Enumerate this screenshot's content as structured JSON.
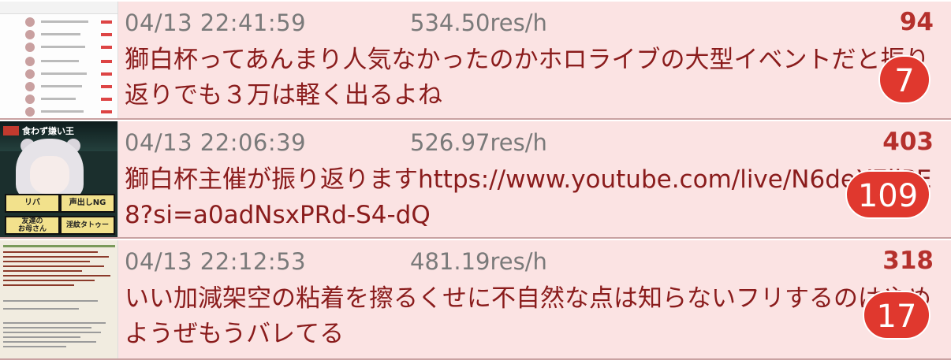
{
  "threads": [
    {
      "date": "04/13 22:41:59",
      "speed": "534.50res/h",
      "count": "94",
      "title": "獅白杯ってあんまり人気なかったのかホロライブの大型イベントだと振り返りでも３万は軽く出るよね",
      "badge": "7",
      "thumbnail": "list-screenshot"
    },
    {
      "date": "04/13 22:06:39",
      "speed": "526.97res/h",
      "count": "403",
      "title": "獅白杯主催が振り返りますhttps://www.youtube.com/live/N6deX7jjPE8?si=a0adNsxPRd-S4-dQ",
      "badge": "109",
      "thumbnail": "stream-screenshot",
      "thumb_text": {
        "title": "食わず嫌い王",
        "cells": [
          "リバ",
          "声出しNG",
          "友達の\nお母さん",
          "淫紋タトゥー"
        ]
      }
    },
    {
      "date": "04/13 22:12:53",
      "speed": "481.19res/h",
      "count": "318",
      "title": "いい加減架空の粘着を擦るくせに不自然な点は知らないフリするのはやめようぜもうバレてる",
      "badge": "17",
      "thumbnail": "post-screenshot"
    }
  ],
  "colors": {
    "row_bg": "#fbe3e3",
    "title": "#8a1c1c",
    "count": "#b5302c",
    "badge": "#e0382e",
    "meta": "#7a7a7a"
  }
}
